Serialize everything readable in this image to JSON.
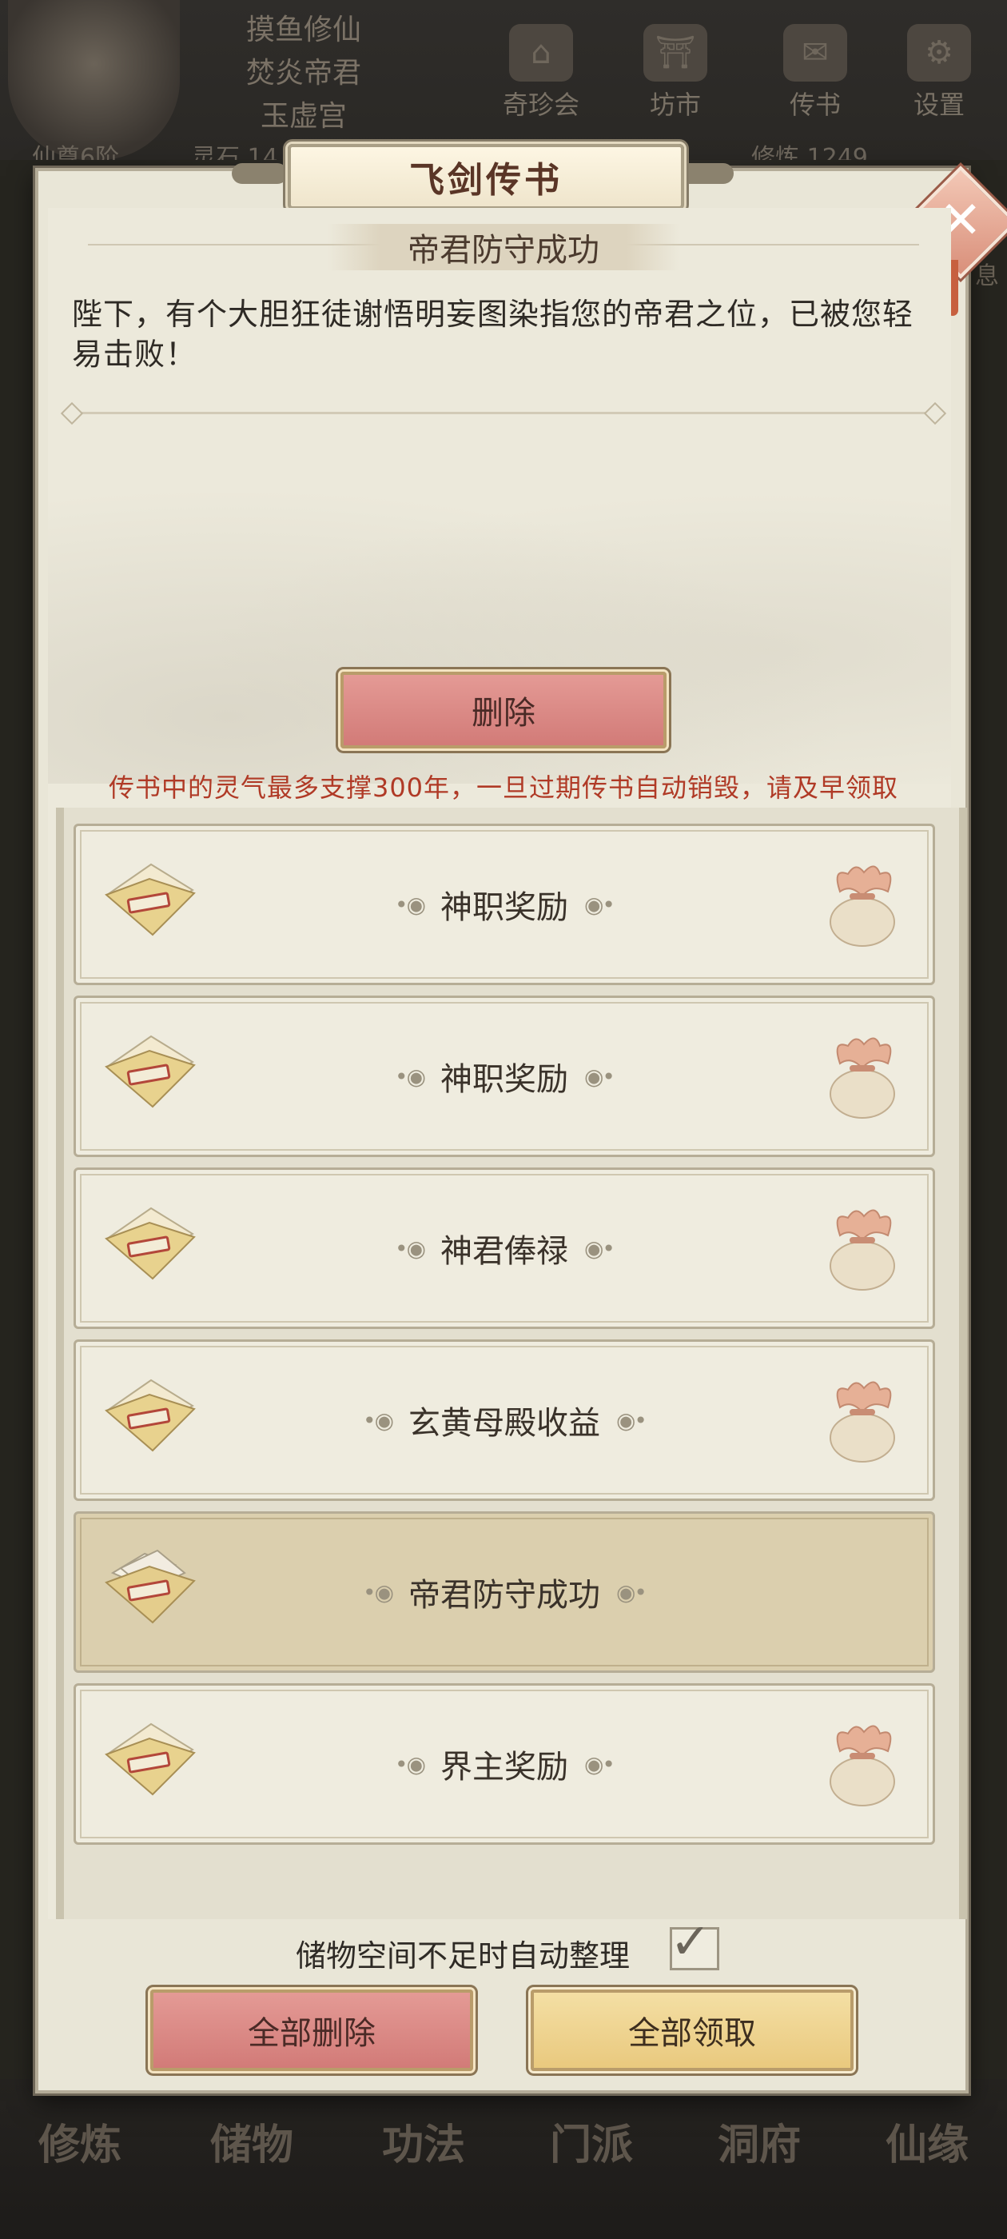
{
  "background": {
    "names": [
      "摸鱼修仙",
      "焚炎帝君",
      "玉虚宫"
    ],
    "rank": "仙尊6阶",
    "resource_left": "灵石 14",
    "resource_right": "修炼 1249",
    "top_icons": [
      {
        "label": "奇珍会",
        "icon": "pavilion-icon"
      },
      {
        "label": "坊市",
        "icon": "market-icon"
      },
      {
        "label": "传书",
        "icon": "letter-icon"
      },
      {
        "label": "设置",
        "icon": "gear-icon"
      }
    ],
    "side_hint": "息",
    "bottom_nav": [
      "修炼",
      "储物",
      "功法",
      "门派",
      "洞府",
      "仙缘"
    ]
  },
  "dialog": {
    "title": "飞剑传书",
    "message": {
      "header": "帝君防守成功",
      "body": "陛下，有个大胆狂徒谢悟明妄图染指您的帝君之位，已被您轻易击败！"
    },
    "delete_label": "删除",
    "warning": "传书中的灵气最多支撑300年，一旦过期传书自动销毁，请及早领取",
    "mails": [
      {
        "title": "神职奖励",
        "has_reward": true,
        "selected": false
      },
      {
        "title": "神职奖励",
        "has_reward": true,
        "selected": false
      },
      {
        "title": "神君俸禄",
        "has_reward": true,
        "selected": false
      },
      {
        "title": "玄黄母殿收益",
        "has_reward": true,
        "selected": false
      },
      {
        "title": "帝君防守成功",
        "has_reward": false,
        "selected": true
      },
      {
        "title": "界主奖励",
        "has_reward": true,
        "selected": false
      }
    ],
    "auto_sort_label": "储物空间不足时自动整理",
    "auto_sort_checked": true,
    "delete_all_label": "全部删除",
    "claim_all_label": "全部领取"
  },
  "colors": {
    "title_text": "#5a3526",
    "warning": "#b03a26",
    "delete_button": "#d27b78",
    "claim_button": "#e9c97e",
    "selected_row": "#dbcfae"
  }
}
